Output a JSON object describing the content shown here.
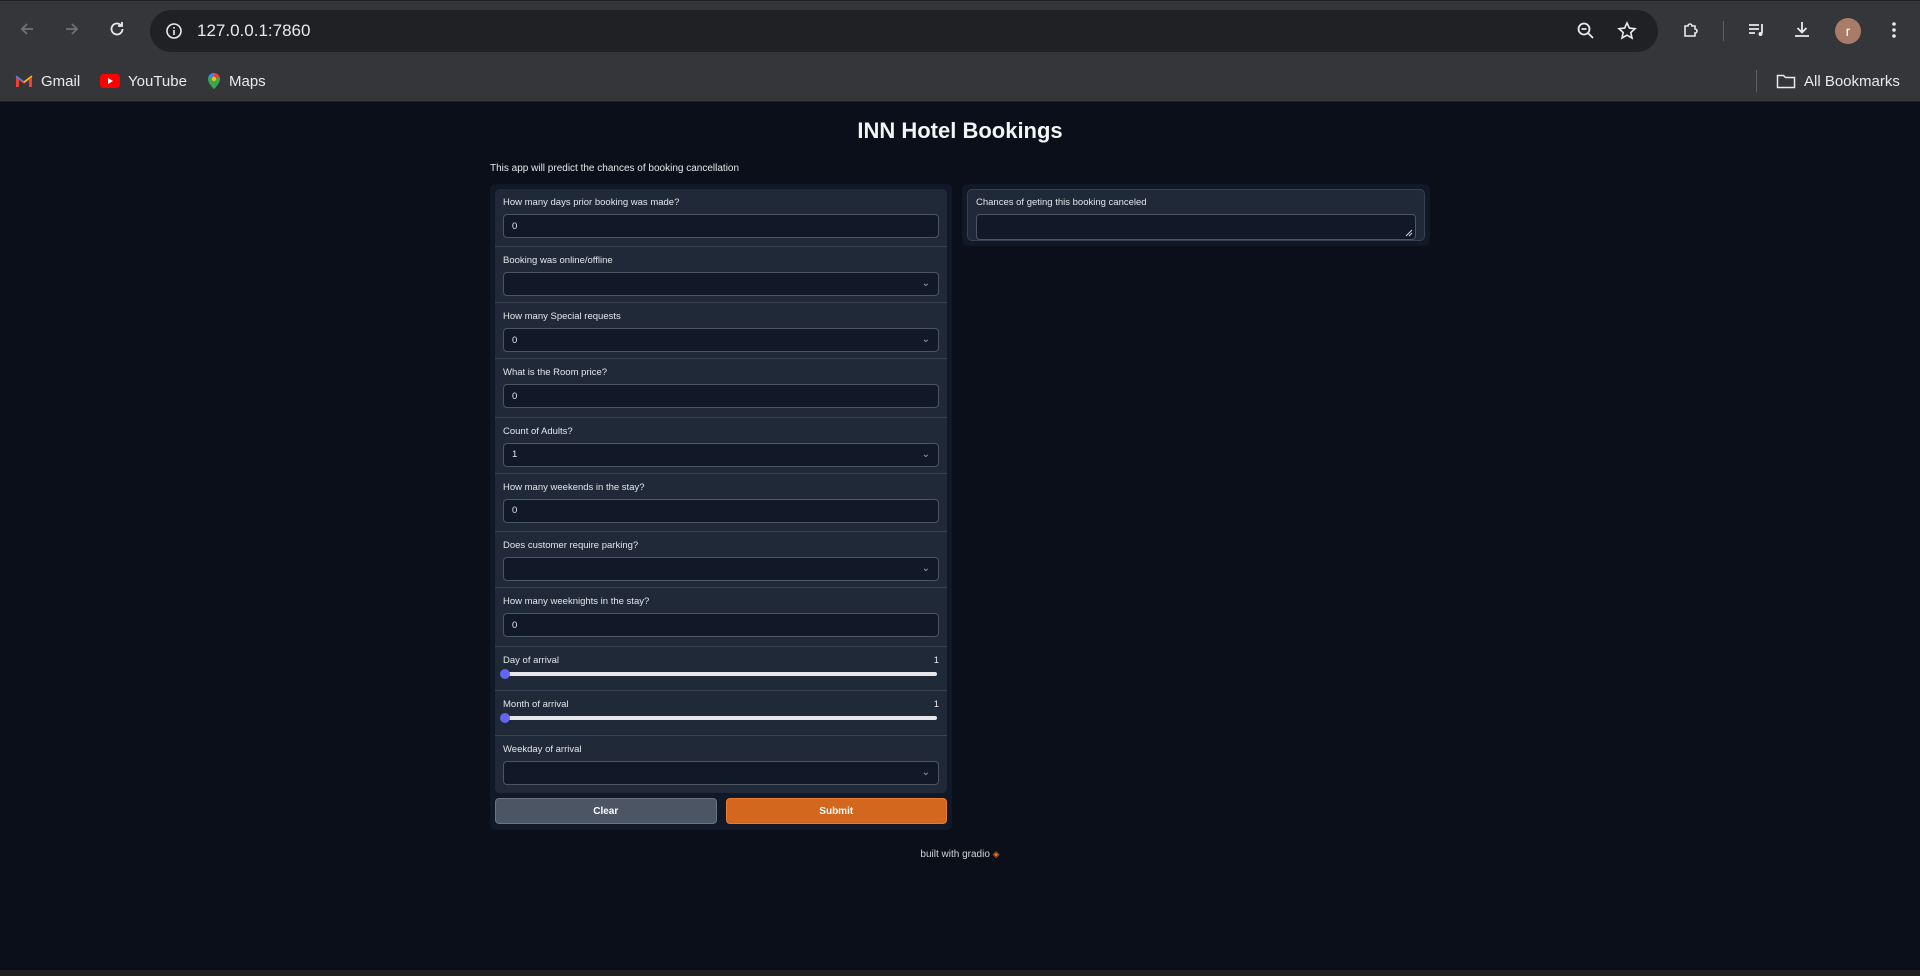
{
  "browser": {
    "url": "127.0.0.1:7860",
    "profile_initial": "r",
    "bookmarks": [
      {
        "label": "Gmail",
        "icon": "gmail-icon"
      },
      {
        "label": "YouTube",
        "icon": "youtube-icon"
      },
      {
        "label": "Maps",
        "icon": "maps-icon"
      }
    ],
    "all_bookmarks_label": "All Bookmarks"
  },
  "app": {
    "title": "INN Hotel Bookings",
    "description": "This app will predict the chances of booking cancellation",
    "accent_color": "#d4671e",
    "slider_color": "#6366f1"
  },
  "inputs": {
    "lead_time": {
      "label": "How many days prior booking was made?",
      "value": "0"
    },
    "market_segment": {
      "label": "Booking was online/offline",
      "value": ""
    },
    "special_requests": {
      "label": "How many Special requests",
      "value": "0"
    },
    "room_price": {
      "label": "What is the Room price?",
      "value": "0"
    },
    "adults": {
      "label": "Count of Adults?",
      "value": "1"
    },
    "weekend_nights": {
      "label": "How many weekends in the stay?",
      "value": "0"
    },
    "parking": {
      "label": "Does customer require parking?",
      "value": ""
    },
    "week_nights": {
      "label": "How many weeknights in the stay?",
      "value": "0"
    },
    "arrival_day": {
      "label": "Day of arrival",
      "value": "1",
      "fraction": 0
    },
    "arrival_month": {
      "label": "Month of arrival",
      "value": "1",
      "fraction": 0
    },
    "arrival_weekday": {
      "label": "Weekday of arrival",
      "value": ""
    }
  },
  "buttons": {
    "clear": "Clear",
    "submit": "Submit"
  },
  "output": {
    "label": "Chances of geting this booking canceled",
    "value": ""
  },
  "footer": {
    "text": "built with gradio"
  }
}
